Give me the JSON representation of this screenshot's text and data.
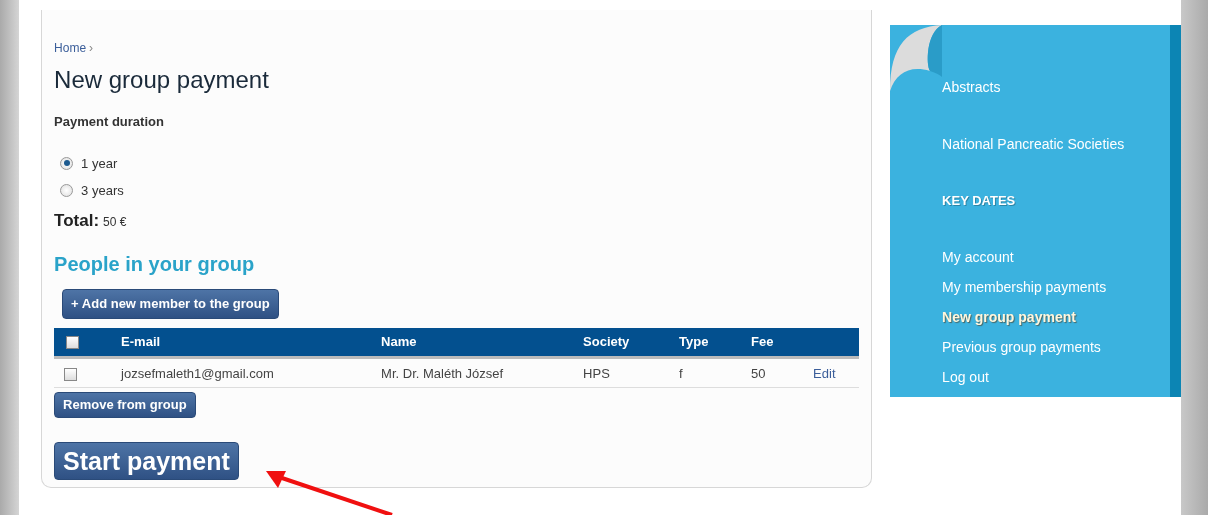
{
  "breadcrumb": {
    "link": "Home",
    "separator": "›"
  },
  "title": "New group payment",
  "duration": {
    "label": "Payment duration",
    "options": [
      {
        "label": "1 year",
        "selected": true
      },
      {
        "label": "3 years",
        "selected": false
      }
    ]
  },
  "total": {
    "label": "Total:",
    "value": "50 €"
  },
  "group_heading": "People in your group",
  "add_button": "+ Add new member to the group",
  "table": {
    "select_all_checked": false,
    "columns": [
      "E-mail",
      "Name",
      "Society",
      "Type",
      "Fee"
    ],
    "rows": [
      {
        "checked": false,
        "cells": [
          "jozsefmaleth1@gmail.com",
          "Mr. Dr. Maléth József",
          "HPS",
          "f",
          "50"
        ],
        "action": "Edit"
      }
    ]
  },
  "remove_button": "Remove from group",
  "start_button": "Start payment",
  "sidebar": {
    "items": [
      {
        "kind": "section",
        "label": "Abstracts",
        "selected": false
      },
      {
        "kind": "section",
        "label": "National Pancreatic Societies",
        "selected": false
      },
      {
        "kind": "heading",
        "label": "KEY DATES",
        "selected": false
      },
      {
        "kind": "link",
        "label": "My account",
        "selected": false
      },
      {
        "kind": "link",
        "label": "My membership payments",
        "selected": false
      },
      {
        "kind": "link",
        "label": "New group payment",
        "selected": true
      },
      {
        "kind": "link",
        "label": "Previous group payments",
        "selected": false
      },
      {
        "kind": "link",
        "label": "Log out",
        "selected": false
      }
    ]
  }
}
